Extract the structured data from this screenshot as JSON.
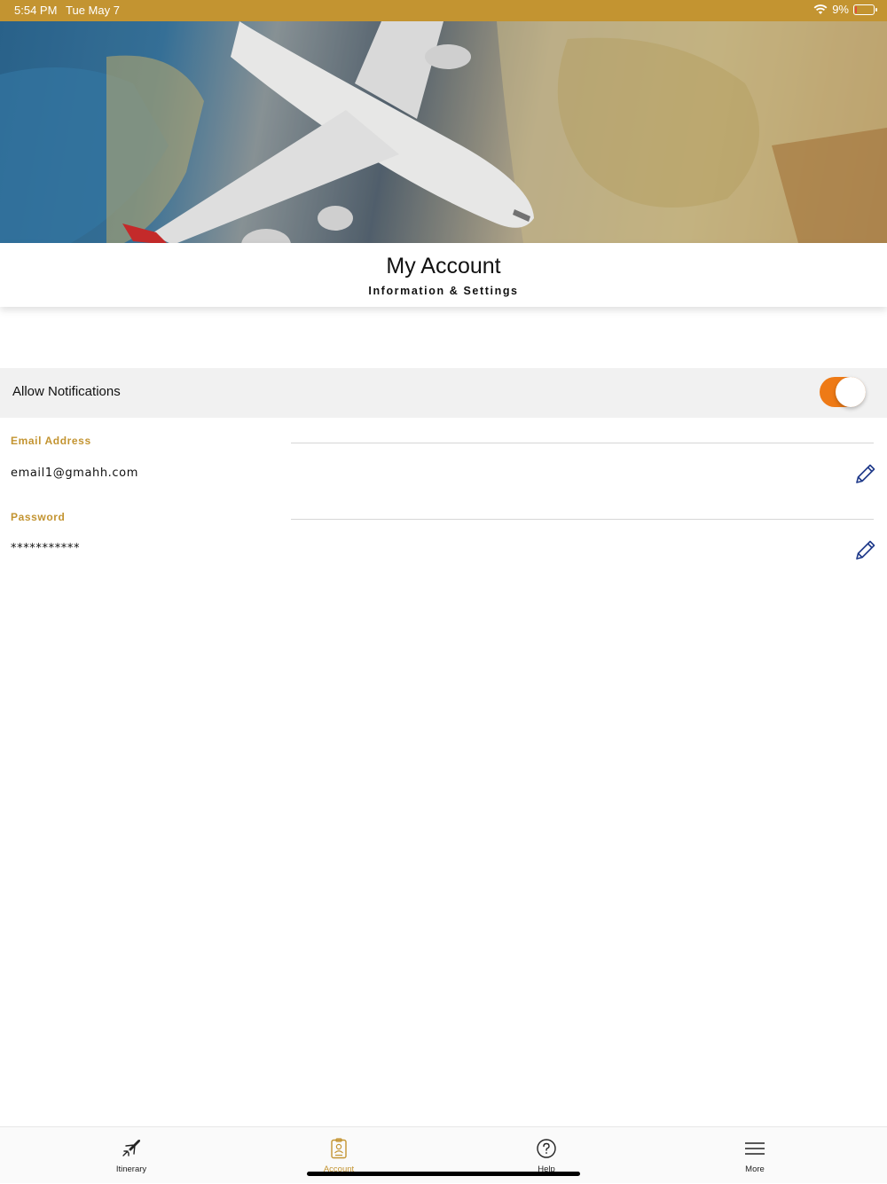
{
  "status_bar": {
    "time": "5:54 PM",
    "date": "Tue May 7",
    "battery_percent": "9%",
    "wifi_icon": "wifi-icon",
    "battery_icon": "battery-charging-icon"
  },
  "header": {
    "title": "My Account",
    "subtitle": "Information & Settings"
  },
  "notifications": {
    "label": "Allow Notifications",
    "enabled": true,
    "toggle_color": "#ee7a16"
  },
  "fields": {
    "email": {
      "label": "Email Address",
      "value": "email1@gmahh.com",
      "edit_icon": "pencil-icon"
    },
    "password": {
      "label": "Password",
      "value": "***********",
      "edit_icon": "pencil-icon"
    }
  },
  "tabs": [
    {
      "label": "Itinerary",
      "icon": "airplane-icon",
      "active": false
    },
    {
      "label": "Account",
      "icon": "id-badge-icon",
      "active": true
    },
    {
      "label": "Help",
      "icon": "question-circle-icon",
      "active": false
    },
    {
      "label": "More",
      "icon": "menu-icon",
      "active": false
    }
  ],
  "colors": {
    "accent_gold": "#c39431",
    "toggle_orange": "#ee7a16",
    "edit_icon_blue": "#1f3a8a"
  }
}
